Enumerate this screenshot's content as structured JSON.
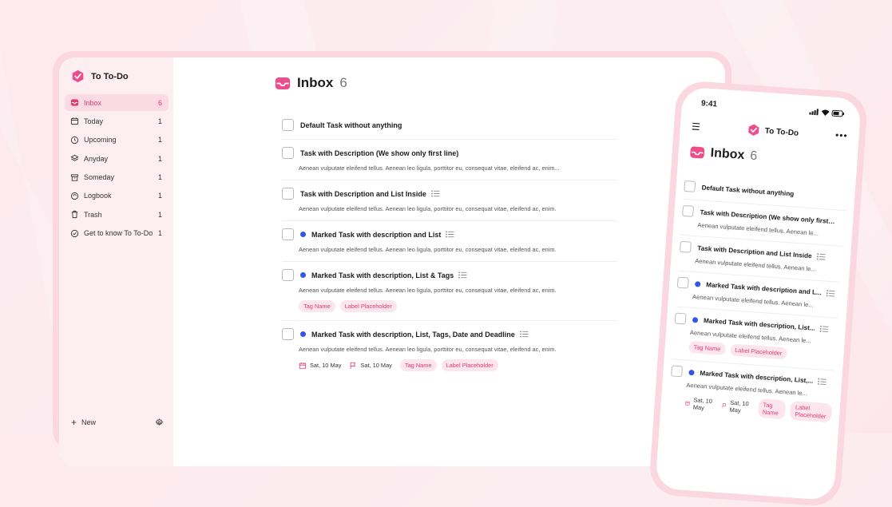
{
  "app": {
    "name": "To To-Do"
  },
  "colors": {
    "accent": "#e23a79",
    "marker": "#3355e8",
    "tag_bg": "#fde5ec"
  },
  "sidebar": {
    "items": [
      {
        "label": "Inbox",
        "count": "6",
        "icon": "inbox-icon",
        "active": true
      },
      {
        "label": "Today",
        "count": "1",
        "icon": "calendar-icon"
      },
      {
        "label": "Upcoming",
        "count": "1",
        "icon": "clock-icon"
      },
      {
        "label": "Anyday",
        "count": "1",
        "icon": "layers-icon"
      },
      {
        "label": "Someday",
        "count": "1",
        "icon": "archive-icon"
      },
      {
        "label": "Logbook",
        "count": "1",
        "icon": "book-icon"
      },
      {
        "label": "Trash",
        "count": "1",
        "icon": "trash-icon"
      },
      {
        "label": "Get to know To To-Do",
        "count": "1",
        "icon": "check-circle-icon"
      }
    ],
    "new_label": "New"
  },
  "main": {
    "title": "Inbox",
    "count": "6",
    "tasks": [
      {
        "title": "Default Task without anything"
      },
      {
        "title": "Task with Description (We show only first line)",
        "desc": "Aenean vulputate eleifend tellus. Aenean leo ligula, porttitor eu, consequat vitae, eleifend ac, enim..."
      },
      {
        "title": "Task with Description and List Inside",
        "desc": "Aenean vulputate eleifend tellus. Aenean leo ligula, porttitor eu, consequat vitae, eleifend ac, enim."
      },
      {
        "title": "Marked Task with description and List",
        "desc": "Aenean vulputate eleifend tellus. Aenean leo ligula, porttitor eu, consequat vitae, eleifend ac, enim."
      },
      {
        "title": "Marked Task with description, List & Tags",
        "desc": "Aenean vulputate eleifend tellus. Aenean leo ligula, porttitor eu, consequat vitae, eleifend ac, enim.",
        "tags": [
          "Tag Name",
          "Label Placeholder"
        ]
      },
      {
        "title": "Marked Task with description, List, Tags, Date and Deadline",
        "desc": "Aenean vulputate eleifend tellus. Aenean leo ligula, porttitor eu, consequat vitae, eleifend ac, enim.",
        "date": "Sat, 10 May",
        "deadline": "Sat, 10 May",
        "tags": [
          "Tag Name",
          "Label Placeholder"
        ]
      }
    ]
  },
  "phone": {
    "time": "9:41",
    "brand": "To To-Do",
    "title": "Inbox",
    "count": "6",
    "tasks": [
      {
        "title": "Default Task without anything"
      },
      {
        "title": "Task with Description (We show only first li...",
        "desc": "Aenean vulputate eleifend tellus. Aenean le..."
      },
      {
        "title": "Task with Description and List Inside",
        "desc": "Aenean vulputate eleifend tellus. Aenean le..."
      },
      {
        "title": "Marked Task with description and L...",
        "desc": "Aenean vulputate eleifend tellus. Aenean le..."
      },
      {
        "title": "Marked Task with description, List...",
        "desc": "Aenean vulputate eleifend tellus. Aenean le...",
        "tags": [
          "Tag Name",
          "Label Placeholder"
        ]
      },
      {
        "title": "Marked Task with description, List,...",
        "desc": "Aenean vulputate eleifend tellus. Aenean le...",
        "tags": [
          "Tag Name",
          "Label Placeholder"
        ],
        "date": "Sat, 10 May",
        "deadline": "Sat, 10 May"
      }
    ]
  }
}
